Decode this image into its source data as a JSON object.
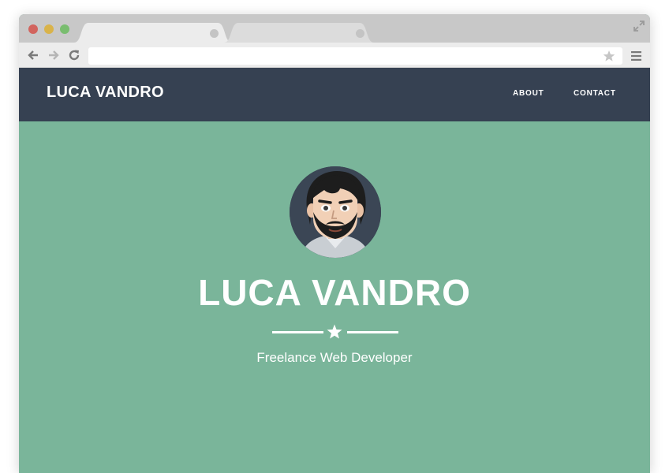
{
  "browser": {
    "address_value": "",
    "toolbar_icons": [
      "back-arrow-icon",
      "forward-arrow-icon",
      "reload-icon",
      "star-icon",
      "menu-icon",
      "expand-icon"
    ]
  },
  "navbar": {
    "brand": "LUCA VANDRO",
    "links": [
      {
        "label": "ABOUT"
      },
      {
        "label": "CONTACT"
      }
    ],
    "background": "#364152"
  },
  "hero": {
    "title": "LUCA VANDRO",
    "subtitle": "Freelance Web Developer",
    "background": "#7ab59a",
    "divider_icon": "star-icon",
    "avatar": "avatar-illustration"
  }
}
